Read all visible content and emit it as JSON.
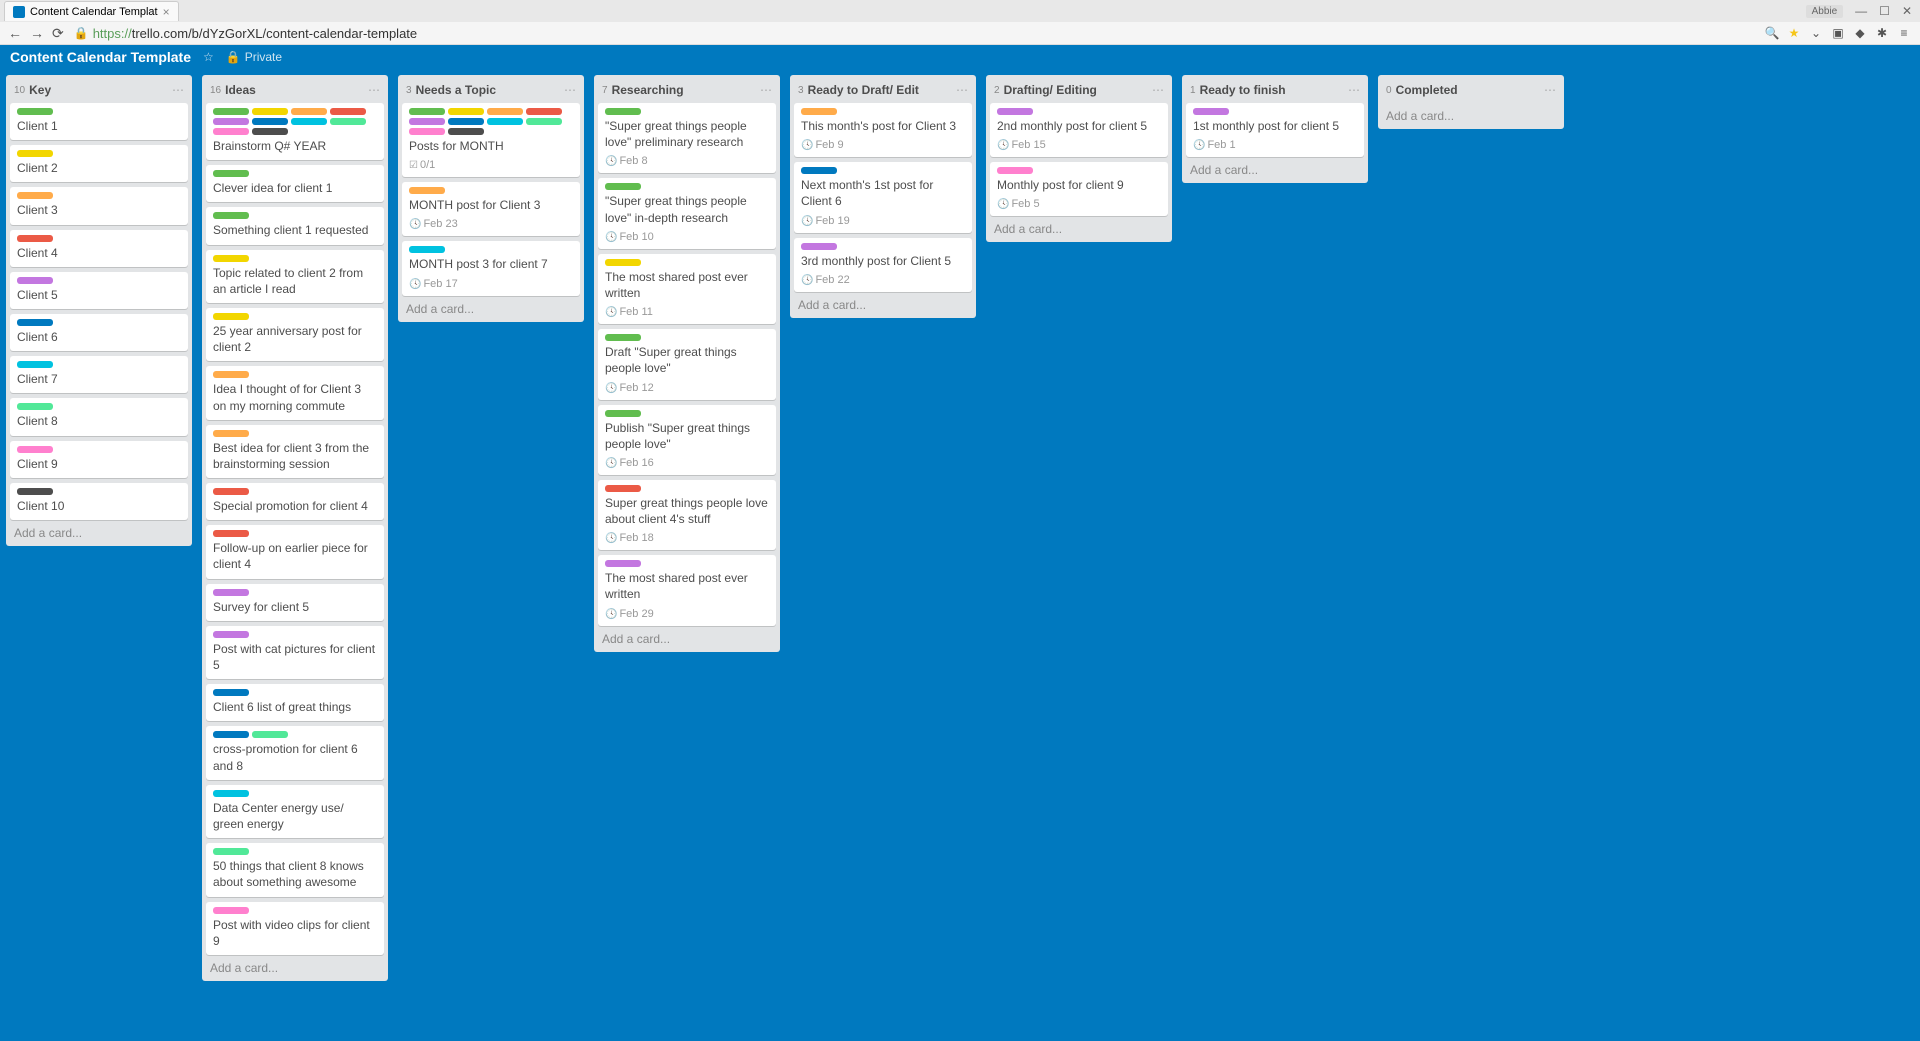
{
  "browser": {
    "tab_title": "Content Calendar Templat",
    "user_label": "Abbie",
    "url_proto": "https://",
    "url_rest": "trello.com/b/dYzGorXL/content-calendar-template"
  },
  "header": {
    "board_title": "Content Calendar Template",
    "visibility": "Private"
  },
  "add_card_text": "Add a card...",
  "lists": [
    {
      "count": "10",
      "title": "Key",
      "cards": [
        {
          "labels": [
            "green"
          ],
          "title": "Client 1"
        },
        {
          "labels": [
            "yellow"
          ],
          "title": "Client 2"
        },
        {
          "labels": [
            "orange"
          ],
          "title": "Client 3"
        },
        {
          "labels": [
            "red"
          ],
          "title": "Client 4"
        },
        {
          "labels": [
            "purple"
          ],
          "title": "Client 5"
        },
        {
          "labels": [
            "blue"
          ],
          "title": "Client 6"
        },
        {
          "labels": [
            "sky"
          ],
          "title": "Client 7"
        },
        {
          "labels": [
            "lime"
          ],
          "title": "Client 8"
        },
        {
          "labels": [
            "pink"
          ],
          "title": "Client 9"
        },
        {
          "labels": [
            "black"
          ],
          "title": "Client 10"
        }
      ]
    },
    {
      "count": "16",
      "title": "Ideas",
      "cards": [
        {
          "labels": [
            "green",
            "yellow",
            "orange",
            "red",
            "purple",
            "blue",
            "sky",
            "lime",
            "pink",
            "black"
          ],
          "title": "Brainstorm Q# YEAR"
        },
        {
          "labels": [
            "green"
          ],
          "title": "Clever idea for client 1"
        },
        {
          "labels": [
            "green"
          ],
          "title": "Something client 1 requested"
        },
        {
          "labels": [
            "yellow"
          ],
          "title": "Topic related to client 2 from an article I read"
        },
        {
          "labels": [
            "yellow"
          ],
          "title": "25 year anniversary post for client 2"
        },
        {
          "labels": [
            "orange"
          ],
          "title": "Idea I thought of for Client 3 on my morning commute"
        },
        {
          "labels": [
            "orange"
          ],
          "title": "Best idea for client 3 from the brainstorming session"
        },
        {
          "labels": [
            "red"
          ],
          "title": "Special promotion for client 4"
        },
        {
          "labels": [
            "red"
          ],
          "title": "Follow-up on earlier piece for client 4"
        },
        {
          "labels": [
            "purple"
          ],
          "title": "Survey for client 5"
        },
        {
          "labels": [
            "purple"
          ],
          "title": "Post with cat pictures for client 5"
        },
        {
          "labels": [
            "blue"
          ],
          "title": "Client 6 list of great things"
        },
        {
          "labels": [
            "blue",
            "lime"
          ],
          "title": "cross-promotion for client 6 and 8"
        },
        {
          "labels": [
            "sky"
          ],
          "title": "Data Center energy use/ green energy"
        },
        {
          "labels": [
            "lime"
          ],
          "title": "50 things that client 8 knows about something awesome"
        },
        {
          "labels": [
            "pink"
          ],
          "title": "Post with video clips for client 9"
        }
      ]
    },
    {
      "count": "3",
      "title": "Needs a Topic",
      "cards": [
        {
          "labels": [
            "green",
            "yellow",
            "orange",
            "red",
            "purple",
            "blue",
            "sky",
            "lime",
            "pink",
            "black"
          ],
          "title": "Posts for MONTH",
          "checklist": "0/1"
        },
        {
          "labels": [
            "orange"
          ],
          "title": "MONTH post for Client 3",
          "date": "Feb 23"
        },
        {
          "labels": [
            "sky"
          ],
          "title": "MONTH post 3 for client 7",
          "date": "Feb 17"
        }
      ]
    },
    {
      "count": "7",
      "title": "Researching",
      "cards": [
        {
          "labels": [
            "green"
          ],
          "title": "\"Super great things people love\" preliminary research",
          "date": "Feb 8"
        },
        {
          "labels": [
            "green"
          ],
          "title": "\"Super great things people love\" in-depth research",
          "date": "Feb 10"
        },
        {
          "labels": [
            "yellow"
          ],
          "title": "The most shared post ever written",
          "date": "Feb 11"
        },
        {
          "labels": [
            "green"
          ],
          "title": "Draft \"Super great things people love\"",
          "date": "Feb 12"
        },
        {
          "labels": [
            "green"
          ],
          "title": "Publish \"Super great things people love\"",
          "date": "Feb 16"
        },
        {
          "labels": [
            "red"
          ],
          "title": "Super great things people love about client 4's stuff",
          "date": "Feb 18"
        },
        {
          "labels": [
            "purple"
          ],
          "title": "The most shared post ever written",
          "date": "Feb 29"
        }
      ]
    },
    {
      "count": "3",
      "title": "Ready to Draft/ Edit",
      "cards": [
        {
          "labels": [
            "orange"
          ],
          "title": "This month's post for Client 3",
          "date": "Feb 9"
        },
        {
          "labels": [
            "blue"
          ],
          "title": "Next month's 1st post for Client 6",
          "date": "Feb 19"
        },
        {
          "labels": [
            "purple"
          ],
          "title": "3rd monthly post for Client 5",
          "date": "Feb 22"
        }
      ]
    },
    {
      "count": "2",
      "title": "Drafting/ Editing",
      "cards": [
        {
          "labels": [
            "purple"
          ],
          "title": "2nd monthly post for client 5",
          "date": "Feb 15"
        },
        {
          "labels": [
            "pink"
          ],
          "title": "Monthly post for client 9",
          "date": "Feb 5"
        }
      ]
    },
    {
      "count": "1",
      "title": "Ready to finish",
      "cards": [
        {
          "labels": [
            "purple"
          ],
          "title": "1st monthly post for client 5",
          "date": "Feb 1"
        }
      ]
    },
    {
      "count": "0",
      "title": "Completed",
      "cards": []
    }
  ]
}
